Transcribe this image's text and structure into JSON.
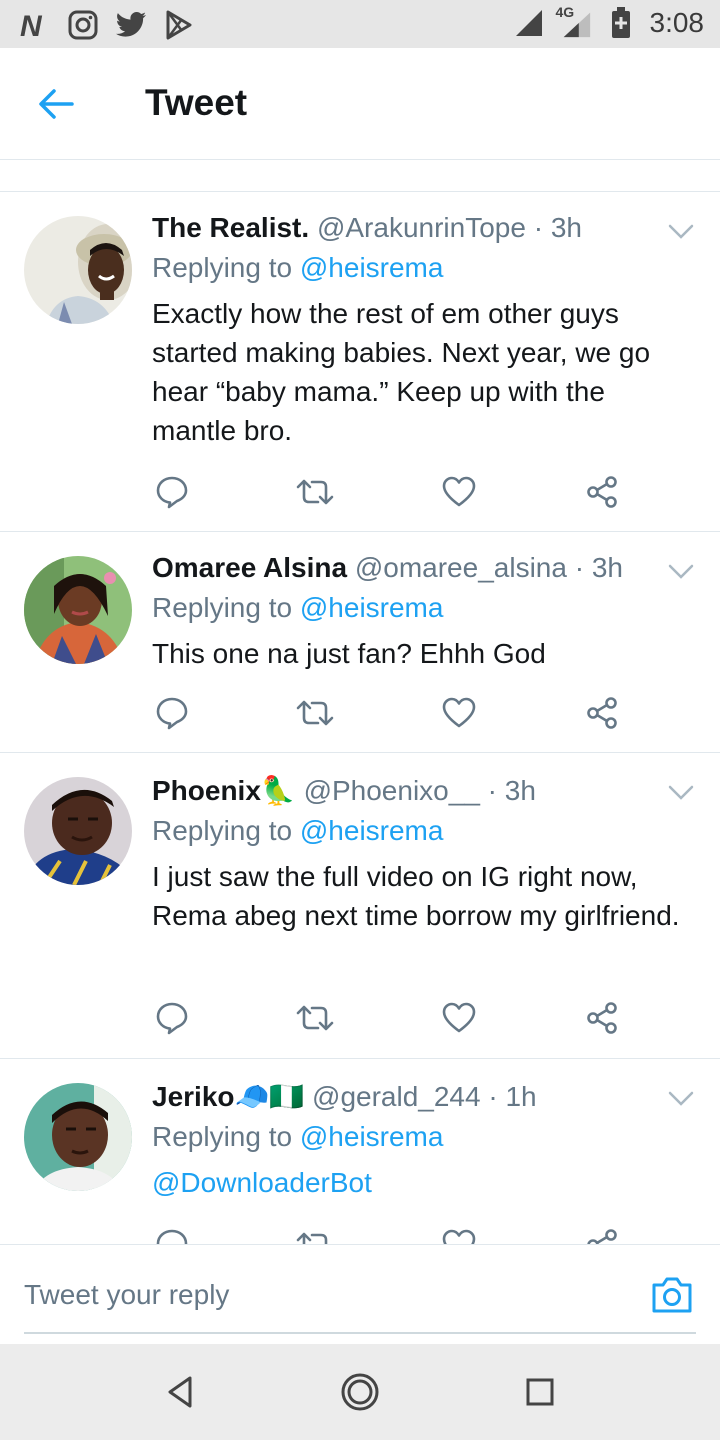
{
  "status_bar": {
    "left_icons": [
      "nairaland-icon",
      "instagram-icon",
      "twitter-icon",
      "play-store-icon"
    ],
    "network": "4G",
    "time": "3:08"
  },
  "header": {
    "title": "Tweet"
  },
  "tweets": [
    {
      "name": "The Realist.",
      "handle": "@ArakunrinTope",
      "time": "3h",
      "replying_prefix": "Replying to",
      "replying_to": "@heisrema",
      "text": "Exactly how the rest of em other guys started making babies. Next year, we go hear “baby mama.” Keep up with the mantle bro."
    },
    {
      "name": "Omaree Alsina",
      "handle": "@omaree_alsina",
      "time": "3h",
      "replying_prefix": "Replying to",
      "replying_to": "@heisrema",
      "text": "This one na just fan? Ehhh God"
    },
    {
      "name": "Phoenix🦜",
      "handle": "@Phoenixo__",
      "time": "3h",
      "replying_prefix": "Replying to",
      "replying_to": "@heisrema",
      "text": "I just saw the full video on IG right now, Rema abeg next time borrow my girlfriend."
    },
    {
      "name": "Jeriko🧢🇳🇬",
      "handle": "@gerald_244",
      "time": "1h",
      "replying_prefix": "Replying to",
      "replying_to": "@heisrema",
      "text": "@DownloaderBot"
    }
  ],
  "composer": {
    "placeholder": "Tweet your reply"
  },
  "colors": {
    "accent": "#1da1f2",
    "secondary_text": "#657786",
    "border": "#e1e8ed"
  }
}
